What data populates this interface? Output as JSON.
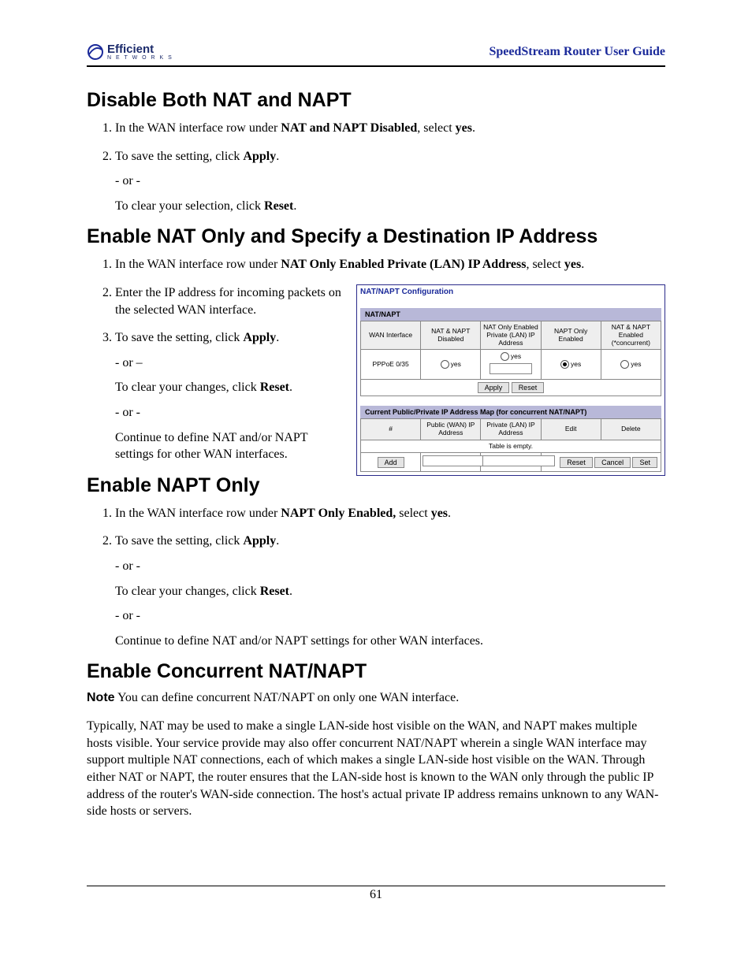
{
  "header": {
    "logo_top": "Efficient",
    "logo_bot": "N E T W O R K S",
    "guide_title": "SpeedStream Router User Guide"
  },
  "sections": {
    "s1": {
      "heading": "Disable Both NAT and NAPT",
      "li1_a": "In the WAN interface row under ",
      "li1_b": "NAT and NAPT Disabled",
      "li1_c": ", select ",
      "li1_d": "yes",
      "li1_e": ".",
      "li2_a": "To save the setting, click ",
      "li2_b": "Apply",
      "li2_c": ".",
      "li2_or": "- or -",
      "li2_d": "To clear your selection, click ",
      "li2_e": "Reset",
      "li2_f": "."
    },
    "s2": {
      "heading": "Enable NAT Only and Specify a Destination IP Address",
      "li1_a": "In the WAN interface row under ",
      "li1_b": "NAT Only Enabled Private (LAN) IP Address",
      "li1_c": ", select ",
      "li1_d": "yes",
      "li1_e": ".",
      "li2": "Enter the IP address for incoming packets on the selected WAN interface.",
      "li3_a": "To save the setting, click ",
      "li3_b": "Apply",
      "li3_c": ".",
      "li3_or1": "- or –",
      "li3_d": "To clear your changes, click ",
      "li3_e": "Reset",
      "li3_f": ".",
      "li3_or2": "- or -",
      "li3_g": "Continue to define NAT and/or NAPT settings for other WAN interfaces."
    },
    "s3": {
      "heading": "Enable NAPT Only",
      "li1_a": "In the WAN interface row under ",
      "li1_b": "NAPT Only Enabled,",
      "li1_c": " select ",
      "li1_d": "yes",
      "li1_e": ".",
      "li2_a": "To save the setting, click ",
      "li2_b": "Apply",
      "li2_c": ".",
      "li2_or1": "- or -",
      "li2_d": "To clear your changes, click ",
      "li2_e": "Reset",
      "li2_f": ".",
      "li2_or2": "- or -",
      "li2_g": "Continue to define NAT and/or NAPT settings for other WAN interfaces."
    },
    "s4": {
      "heading": "Enable Concurrent NAT/NAPT",
      "note_label": "Note",
      "note_text": "  You can define concurrent NAT/NAPT on only one WAN interface.",
      "para": "Typically, NAT may be used to make a single LAN-side host visible on the WAN, and NAPT makes multiple hosts visible. Your service provide may also offer concurrent NAT/NAPT wherein a single WAN interface may support multiple NAT connections, each of which makes a single LAN-side host visible on the WAN. Through either NAT or NAPT, the router ensures that the LAN-side host is known to the WAN only through the public IP address of the router's WAN-side connection.  The host's actual private IP address remains unknown to any WAN-side hosts or servers."
    }
  },
  "figure": {
    "title": "NAT/NAPT Configuration",
    "tab": "NAT/NAPT",
    "cols": {
      "c1": "WAN Interface",
      "c2": "NAT & NAPT Disabled",
      "c3": "NAT Only Enabled Private (LAN) IP Address",
      "c4": "NAPT Only Enabled",
      "c5": "NAT & NAPT Enabled (*concurrent)"
    },
    "row_iface": "PPPoE 0/35",
    "yes": "yes",
    "apply": "Apply",
    "reset": "Reset",
    "map_title": "Current Public/Private IP Address Map (for concurrent NAT/NAPT)",
    "map_cols": {
      "c1": "#",
      "c2": "Public (WAN) IP Address",
      "c3": "Private (LAN) IP Address",
      "c4": "Edit",
      "c5": "Delete"
    },
    "empty": "Table is empty.",
    "add": "Add",
    "cancel": "Cancel",
    "set": "Set"
  },
  "page_number": "61"
}
